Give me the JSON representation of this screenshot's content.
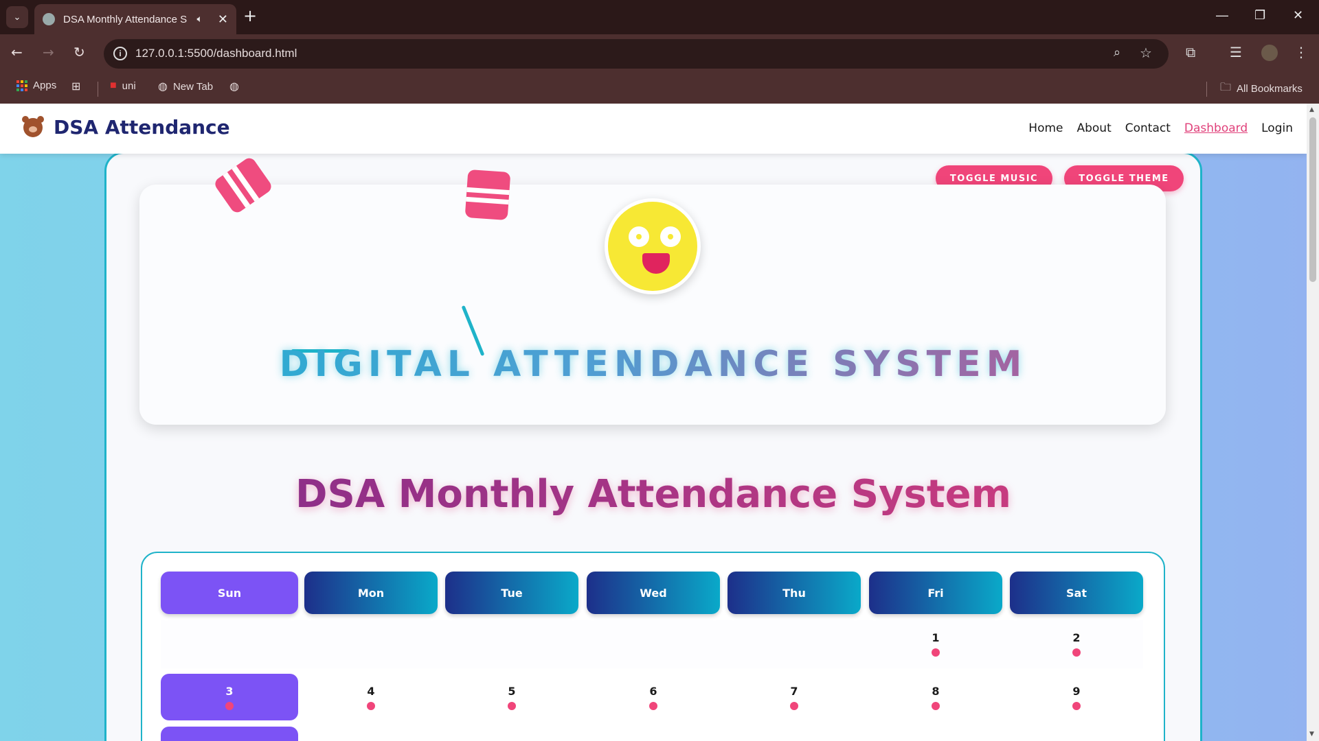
{
  "browser": {
    "tab_title": "DSA Monthly Attendance S",
    "url": "127.0.0.1:5500/dashboard.html",
    "bookmarks": [
      {
        "label": "Apps"
      },
      {
        "label": "uni"
      },
      {
        "label": "New Tab"
      }
    ],
    "all_bookmarks": "All Bookmarks"
  },
  "site": {
    "brand": "DSA Attendance",
    "nav": [
      "Home",
      "About",
      "Contact",
      "Dashboard",
      "Login"
    ],
    "active_nav": "Dashboard"
  },
  "controls": {
    "toggle_music": "TOGGLE MUSIC",
    "toggle_theme": "TOGGLE THEME"
  },
  "hero": {
    "title": "DIGITAL ATTENDANCE SYSTEM"
  },
  "page_title": "DSA Monthly Attendance System",
  "calendar": {
    "days": [
      "Sun",
      "Mon",
      "Tue",
      "Wed",
      "Thu",
      "Fri",
      "Sat"
    ],
    "week1": [
      "",
      "",
      "",
      "",
      "",
      "1",
      "2"
    ],
    "week2": [
      "3",
      "4",
      "5",
      "6",
      "7",
      "8",
      "9"
    ]
  },
  "colors": {
    "accent": "#f0457a",
    "sunday": "#7c53f5",
    "border": "#1fb3c9"
  }
}
